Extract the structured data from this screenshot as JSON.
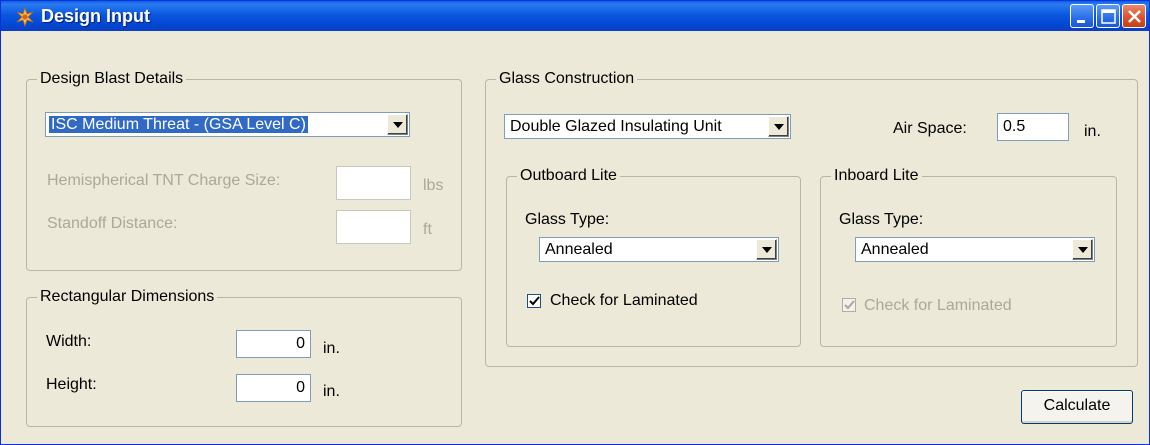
{
  "window": {
    "title": "Design Input",
    "icon": "burst-star-icon",
    "controls": {
      "minimize": "minimize-icon",
      "maximize": "maximize-icon",
      "close": "close-icon"
    }
  },
  "blast": {
    "legend": "Design Blast Details",
    "threat_selected": "ISC Medium Threat - (GSA Level C)",
    "tnt_label": "Hemispherical TNT Charge Size:",
    "tnt_value": "",
    "tnt_unit": "lbs",
    "standoff_label": "Standoff Distance:",
    "standoff_value": "",
    "standoff_unit": "ft"
  },
  "dimensions": {
    "legend": "Rectangular Dimensions",
    "width_label": "Width:",
    "width_value": "0",
    "width_unit": "in.",
    "height_label": "Height:",
    "height_value": "0",
    "height_unit": "in."
  },
  "glass": {
    "legend": "Glass Construction",
    "construction_selected": "Double Glazed Insulating Unit",
    "air_space_label": "Air Space:",
    "air_space_value": "0.5",
    "air_space_unit": "in.",
    "outboard": {
      "legend": "Outboard Lite",
      "type_label": "Glass Type:",
      "type_selected": "Annealed",
      "laminated_label": "Check for Laminated",
      "laminated_checked": true
    },
    "inboard": {
      "legend": "Inboard Lite",
      "type_label": "Glass Type:",
      "type_selected": "Annealed",
      "laminated_label": "Check for Laminated",
      "laminated_checked": true,
      "laminated_disabled": true
    }
  },
  "actions": {
    "calculate_label": "Calculate"
  },
  "colors": {
    "titlebar": "#0b58e0",
    "window_bg": "#ece9d8",
    "selection": "#316ac5",
    "disabled_text": "#aca899"
  }
}
